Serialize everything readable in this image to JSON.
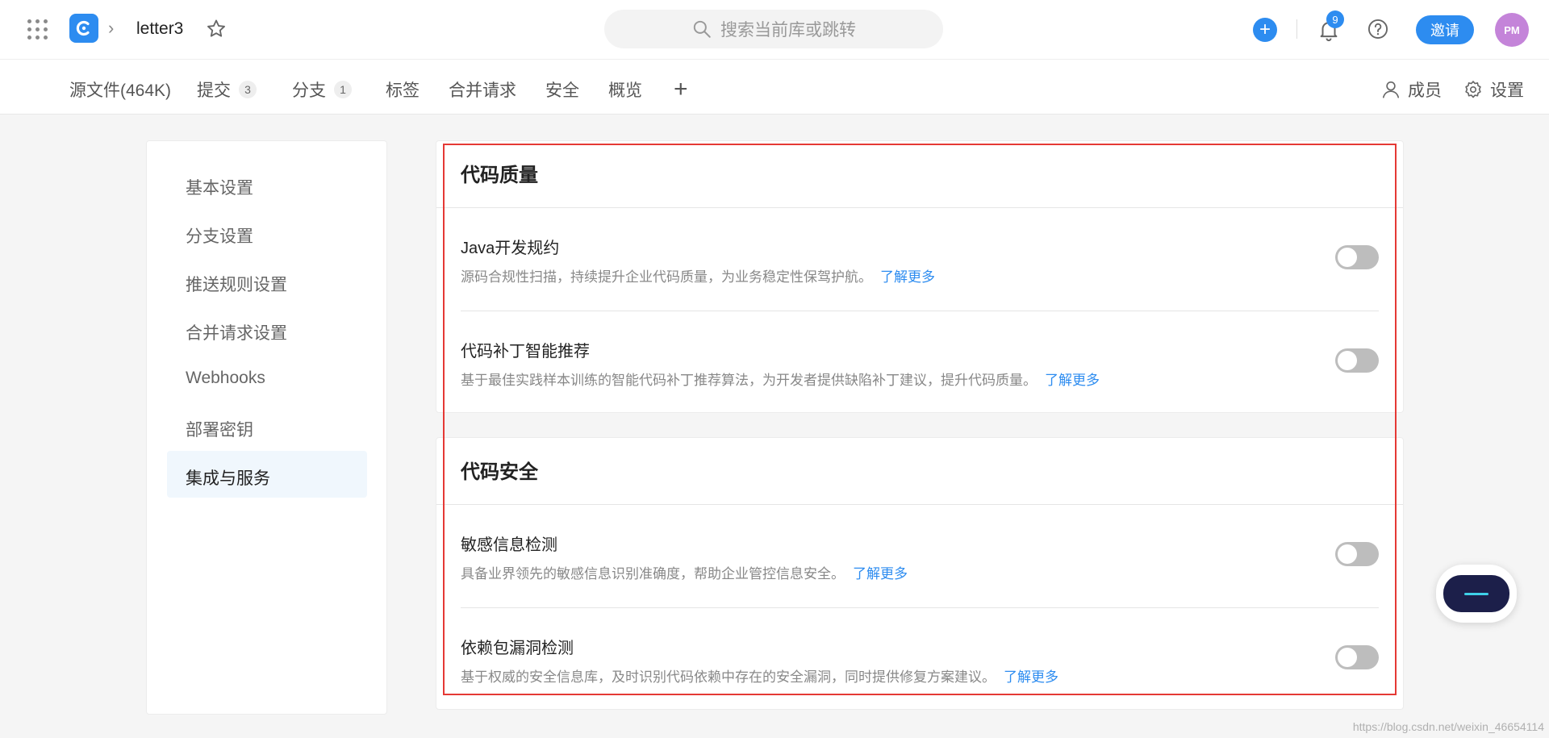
{
  "header": {
    "repo_name": "letter3",
    "search_placeholder": "搜索当前库或跳转",
    "notification_count": "9",
    "invite_label": "邀请",
    "avatar_initials": "PM"
  },
  "tabs": [
    {
      "label": "源文件(464K)"
    },
    {
      "label": "提交",
      "count": "3"
    },
    {
      "label": "分支",
      "count": "1"
    },
    {
      "label": "标签"
    },
    {
      "label": "合并请求"
    },
    {
      "label": "安全"
    },
    {
      "label": "概览"
    }
  ],
  "subnav_right": {
    "members": "成员",
    "settings": "设置"
  },
  "sidebar": {
    "items": [
      {
        "label": "基本设置"
      },
      {
        "label": "分支设置"
      },
      {
        "label": "推送规则设置"
      },
      {
        "label": "合并请求设置"
      },
      {
        "label": "Webhooks"
      },
      {
        "label": "部署密钥"
      },
      {
        "label": "集成与服务",
        "active": true
      }
    ]
  },
  "sections": [
    {
      "title": "代码质量",
      "items": [
        {
          "title": "Java开发规约",
          "desc": "源码合规性扫描，持续提升企业代码质量，为业务稳定性保驾护航。",
          "link": "了解更多",
          "enabled": false
        },
        {
          "title": "代码补丁智能推荐",
          "desc": "基于最佳实践样本训练的智能代码补丁推荐算法，为开发者提供缺陷补丁建议，提升代码质量。",
          "link": "了解更多",
          "enabled": false
        }
      ]
    },
    {
      "title": "代码安全",
      "items": [
        {
          "title": "敏感信息检测",
          "desc": "具备业界领先的敏感信息识别准确度，帮助企业管控信息安全。",
          "link": "了解更多",
          "enabled": false
        },
        {
          "title": "依赖包漏洞检测",
          "desc": "基于权威的安全信息库，及时识别代码依赖中存在的安全漏洞，同时提供修复方案建议。",
          "link": "了解更多",
          "enabled": false
        }
      ]
    }
  ],
  "watermark": "https://blog.csdn.net/weixin_46654114",
  "colors": {
    "accent": "#2d8cf0",
    "highlight_border": "#e53935",
    "toggle_off": "#bdbdbd",
    "avatar_bg": "#c484d9"
  }
}
